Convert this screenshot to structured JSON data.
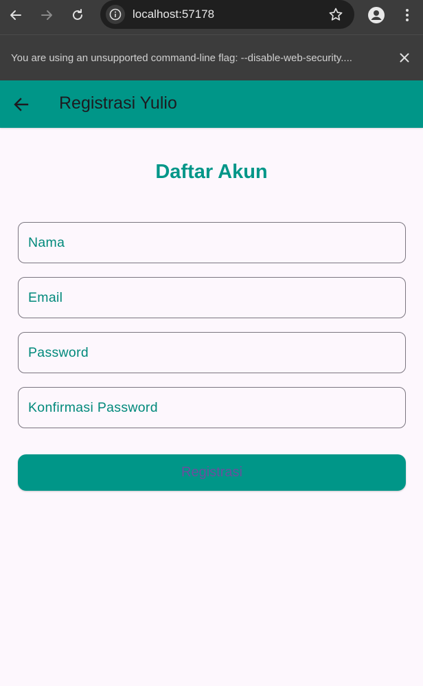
{
  "browser": {
    "url": "localhost:57178",
    "infobar_message": "You are using an unsupported command-line flag: --disable-web-security...."
  },
  "appbar": {
    "title": "Registrasi Yulio"
  },
  "form": {
    "heading": "Daftar Akun",
    "fields": [
      {
        "label": "Nama"
      },
      {
        "label": "Email"
      },
      {
        "label": "Password"
      },
      {
        "label": "Konfirmasi Password"
      }
    ],
    "submit_label": "Registrasi"
  },
  "colors": {
    "primary": "#009688",
    "background": "#fdf7fd",
    "button_text": "#6a4f9e",
    "chrome": "#3c3c3c"
  },
  "icons": {
    "back": "arrow-left-icon",
    "forward": "arrow-right-icon",
    "reload": "reload-icon",
    "info": "info-icon",
    "star": "star-icon",
    "profile": "profile-icon",
    "menu": "more-vert-icon",
    "close": "close-icon"
  }
}
